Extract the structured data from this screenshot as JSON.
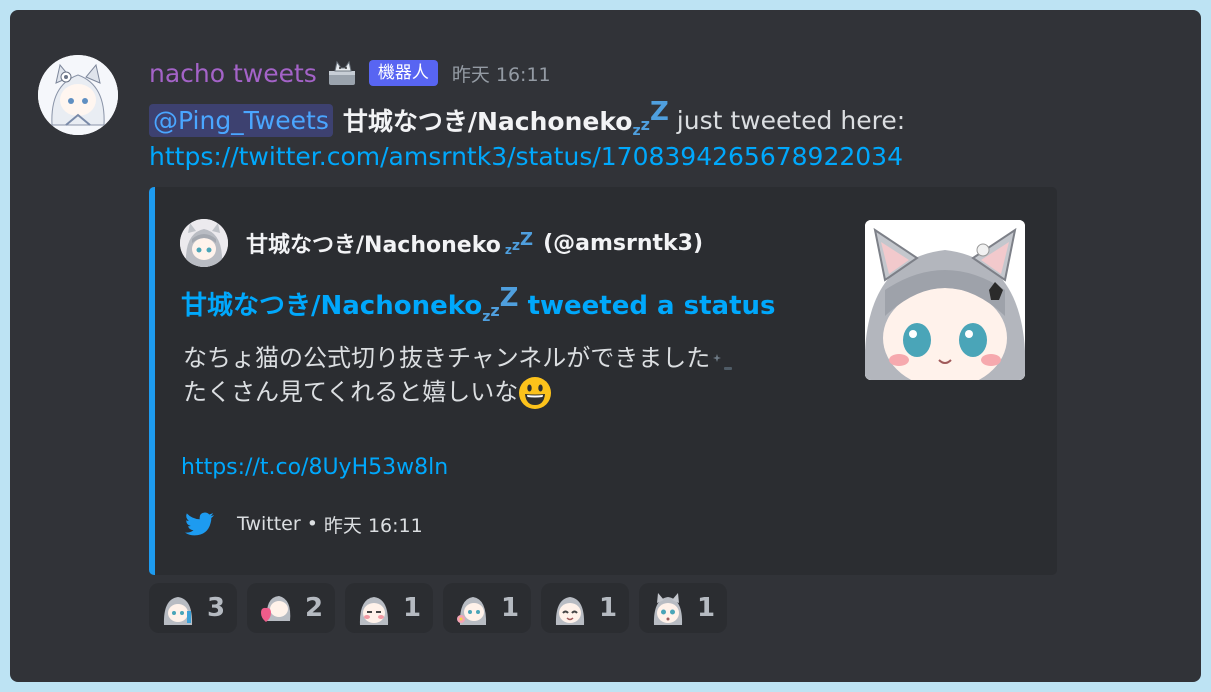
{
  "message": {
    "username": "nacho tweets",
    "bot_badge": "機器人",
    "timestamp": "昨天 16:11",
    "mention": "@Ping_Tweets",
    "author_display_name": "甘城なつき/Nachoneko",
    "trailing_text": "just tweeted here:",
    "tweet_url": "https://twitter.com/amsrntk3/status/1708394265678922034"
  },
  "embed": {
    "author_name": "甘城なつき/Nachoneko",
    "author_handle": "(@amsrntk3)",
    "title_name": "甘城なつき/Nachoneko",
    "title_suffix": "tweeted a status",
    "description_line1": "なちょ猫の公式切り抜きチャンネルができました",
    "description_line2": "たくさん見てくれると嬉しいな",
    "link": "https://t.co/8UyH53w8ln",
    "footer_source": "Twitter",
    "footer_separator": "•",
    "footer_time": "昨天 16:11",
    "accent_color": "#1d9bf0"
  },
  "reactions": [
    {
      "emoji": "cat-girl-sticker-icon",
      "count": "3"
    },
    {
      "emoji": "cat-girl-heart-icon",
      "count": "2"
    },
    {
      "emoji": "cat-girl-blush-icon",
      "count": "1"
    },
    {
      "emoji": "cat-girl-flower-icon",
      "count": "1"
    },
    {
      "emoji": "cat-girl-happy-icon",
      "count": "1"
    },
    {
      "emoji": "cat-girl-surprised-icon",
      "count": "1"
    }
  ]
}
